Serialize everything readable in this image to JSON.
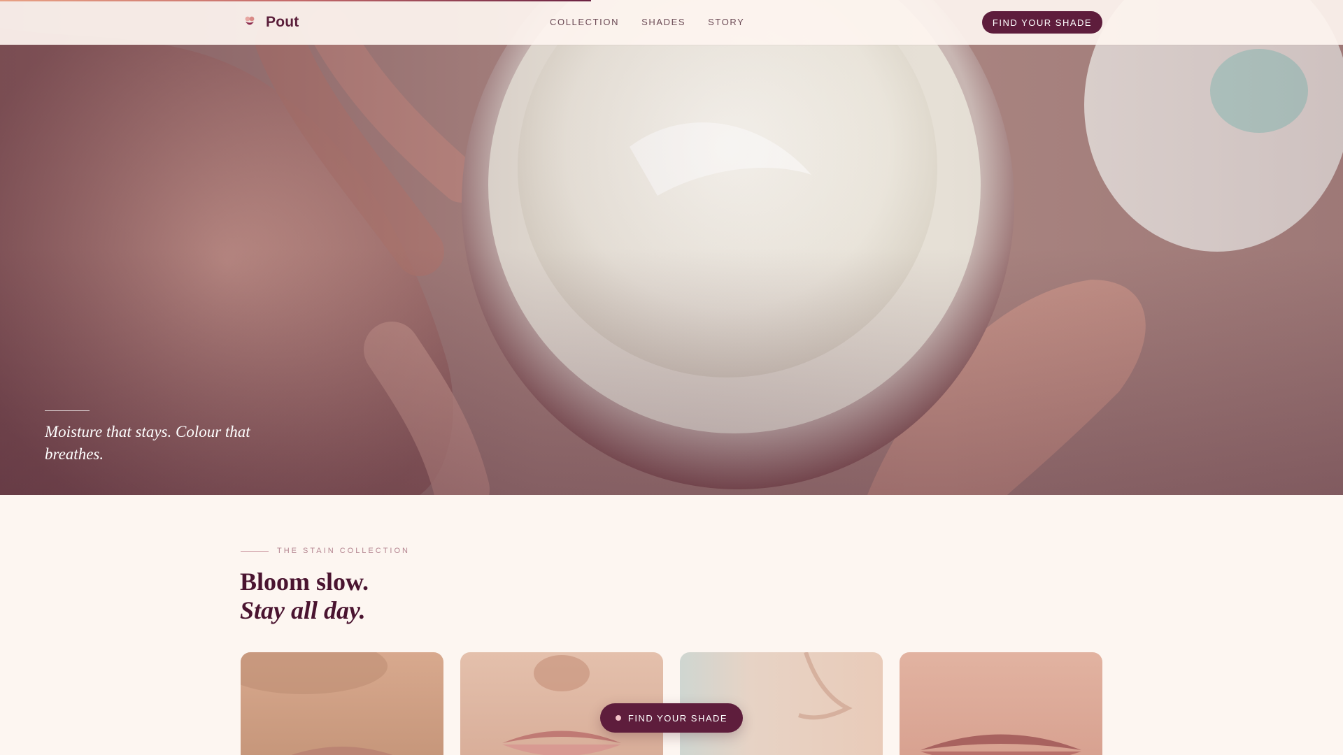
{
  "scroll_progress": 0.44,
  "header": {
    "brand": "Pout",
    "nav": [
      "COLLECTION",
      "SHADES",
      "STORY"
    ],
    "cta_label": "FIND YOUR SHADE"
  },
  "hero": {
    "tagline": "Moisture that stays. Colour that breathes."
  },
  "collection": {
    "eyebrow": "THE STAIN COLLECTION",
    "heading_line1": "Bloom slow.",
    "heading_line2": "Stay all day."
  },
  "floating_cta": {
    "label": "FIND YOUR SHADE"
  },
  "colors": {
    "accent": "#5e1d3c",
    "background": "#fdf6f1",
    "progress_start": "#e8a184",
    "progress_end": "#6b2242"
  },
  "icons": {
    "brand": "lips-flower-icon",
    "cta": "dot-icon"
  }
}
